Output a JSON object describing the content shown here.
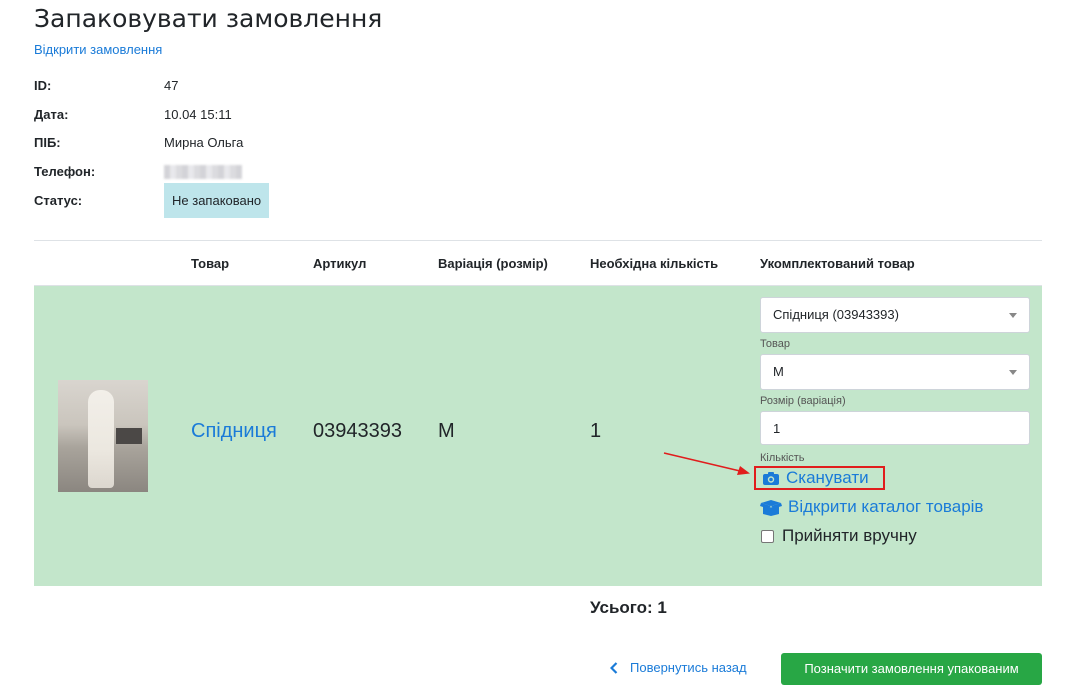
{
  "page": {
    "title": "Запаковувати замовлення",
    "open_order_link": "Відкрити замовлення"
  },
  "order_info": {
    "id_label": "ID:",
    "id_value": "47",
    "date_label": "Дата:",
    "date_value": "10.04 15:11",
    "name_label": "ПІБ:",
    "name_value": "Мирна Ольга",
    "phone_label": "Телефон:",
    "status_label": "Статус:",
    "status_value": "Не запаковано"
  },
  "table": {
    "headers": [
      "Товар",
      "Артикул",
      "Варіація (розмір)",
      "Необхідна кількість",
      "Укомплектований товар"
    ],
    "row": {
      "product_name": "Спідниця",
      "sku": "03943393",
      "variation": "M",
      "required_qty": "1"
    }
  },
  "packing": {
    "product_select_value": "Спідниця (03943393)",
    "product_caption": "Товар",
    "size_select_value": "M",
    "size_caption": "Розмір (варіація)",
    "qty_value": "1",
    "qty_caption": "Кількість",
    "scan_label": "Сканувати",
    "catalog_label": "Відкрити каталог товарів",
    "manual_label": "Прийняти вручну"
  },
  "footer": {
    "total_text": "Усього: 1",
    "back_label": "Повернутись назад",
    "mark_packed_label": "Позначити замовлення упакованим"
  },
  "colors": {
    "link": "#1a7bd8",
    "row_bg": "#c3e6cb",
    "status_bg": "#bee5eb",
    "primary_button": "#28a745",
    "annotation_red": "#e11d1d"
  },
  "icons": [
    "camera-icon",
    "box-icon",
    "chevron-left-icon",
    "caret-down-icon"
  ]
}
